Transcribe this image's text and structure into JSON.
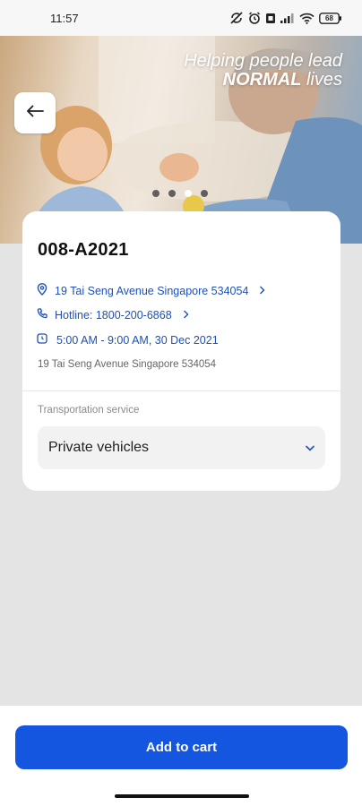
{
  "status_bar": {
    "time": "11:57",
    "battery": "68",
    "icons": [
      "rotate-off-icon",
      "alarm-icon",
      "sim-icon",
      "signal-icon",
      "wifi-icon",
      "battery-icon"
    ]
  },
  "hero": {
    "tagline_line1": "Helping people lead",
    "tagline_bold": "NORMAL",
    "tagline_end": "lives",
    "dots": 4,
    "active_dot": 2
  },
  "listing": {
    "code": "008-A2021",
    "address_link": "19 Tai Seng Avenue Singapore 534054",
    "hotline": "Hotline: 1800-200-6868",
    "time_slot": "5:00 AM - 9:00 AM, 30 Dec 2021",
    "address_plain": "19 Tai Seng Avenue Singapore 534054"
  },
  "transport": {
    "label": "Transportation service",
    "selected": "Private vehicles"
  },
  "actions": {
    "add_to_cart": "Add to cart"
  },
  "colors": {
    "primary": "#1456e0",
    "link": "#1f4fb8",
    "background": "#e4e4e4"
  }
}
